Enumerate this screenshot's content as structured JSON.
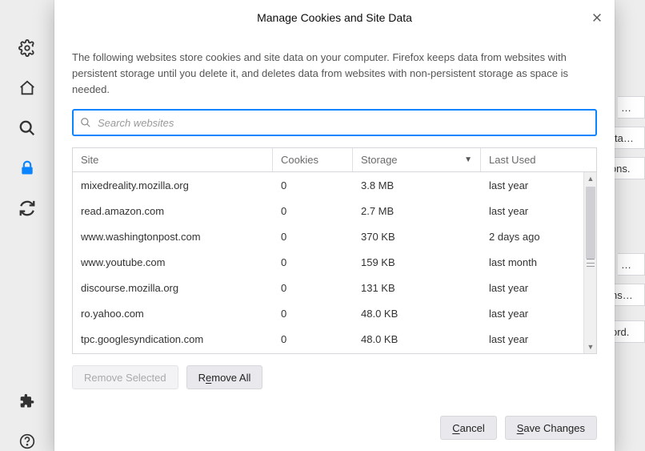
{
  "rail": {
    "items": [
      {
        "name": "general-icon",
        "active": false
      },
      {
        "name": "home-icon",
        "active": false
      },
      {
        "name": "search-prefs-icon",
        "active": false
      },
      {
        "name": "privacy-icon",
        "active": true
      },
      {
        "name": "sync-icon",
        "active": false
      }
    ],
    "bottom": [
      {
        "name": "addons-icon"
      },
      {
        "name": "help-icon"
      }
    ]
  },
  "hints": {
    "h1": "…",
    "h2": "ta…",
    "h3": "ions.",
    "h4": "…",
    "h5": "ns…",
    "h6": "ord."
  },
  "dialog": {
    "title": "Manage Cookies and Site Data",
    "close_tooltip": "Close",
    "blurb": "The following websites store cookies and site data on your computer. Firefox keeps data from websites with persistent storage until you delete it, and deletes data from websites with non-persistent storage as space is needed.",
    "search": {
      "placeholder": "Search websites",
      "value": ""
    },
    "columns": {
      "site": "Site",
      "cookies": "Cookies",
      "storage": "Storage",
      "last": "Last Used",
      "sorted": "storage",
      "sort_dir": "desc"
    },
    "rows": [
      {
        "site": "mixedreality.mozilla.org",
        "cookies": "0",
        "storage": "3.8 MB",
        "last": "last year"
      },
      {
        "site": "read.amazon.com",
        "cookies": "0",
        "storage": "2.7 MB",
        "last": "last year"
      },
      {
        "site": "www.washingtonpost.com",
        "cookies": "0",
        "storage": "370 KB",
        "last": "2 days ago"
      },
      {
        "site": "www.youtube.com",
        "cookies": "0",
        "storage": "159 KB",
        "last": "last month"
      },
      {
        "site": "discourse.mozilla.org",
        "cookies": "0",
        "storage": "131 KB",
        "last": "last year"
      },
      {
        "site": "ro.yahoo.com",
        "cookies": "0",
        "storage": "48.0 KB",
        "last": "last year"
      },
      {
        "site": "tpc.googlesyndication.com",
        "cookies": "0",
        "storage": "48.0 KB",
        "last": "last year"
      }
    ],
    "buttons": {
      "remove_selected": "Remove Selected",
      "remove_all": "Remove All",
      "cancel": "Cancel",
      "save": "Save Changes",
      "cancel_ul": "C",
      "save_ul": "S",
      "remove_all_ul": "e"
    }
  }
}
